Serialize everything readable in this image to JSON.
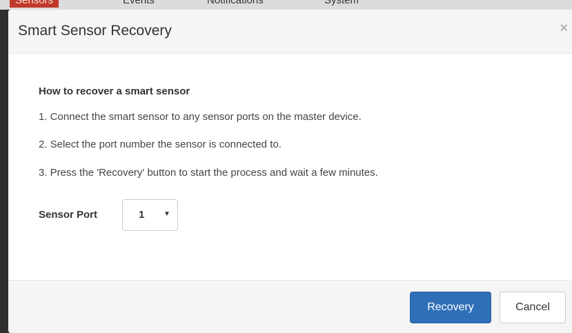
{
  "background_nav": {
    "tabs": [
      {
        "label": "Sensors"
      },
      {
        "label": "Events"
      },
      {
        "label": "Notifications"
      },
      {
        "label": "System"
      }
    ]
  },
  "modal": {
    "title": "Smart Sensor Recovery",
    "close_label": "×",
    "heading": "How to recover a smart sensor",
    "steps": [
      "1. Connect the smart sensor to any sensor ports on the master device.",
      "2. Select the port number the sensor is connected to.",
      "3. Press the 'Recovery' button to start the process and wait a few minutes."
    ],
    "sensor_port": {
      "label": "Sensor Port",
      "selected": "1",
      "caret": "▼"
    },
    "buttons": {
      "recovery": "Recovery",
      "cancel": "Cancel"
    }
  },
  "colors": {
    "primary": "#2f6fb7",
    "header_bg": "#f5f5f5",
    "backdrop": "#2f2f2f"
  }
}
